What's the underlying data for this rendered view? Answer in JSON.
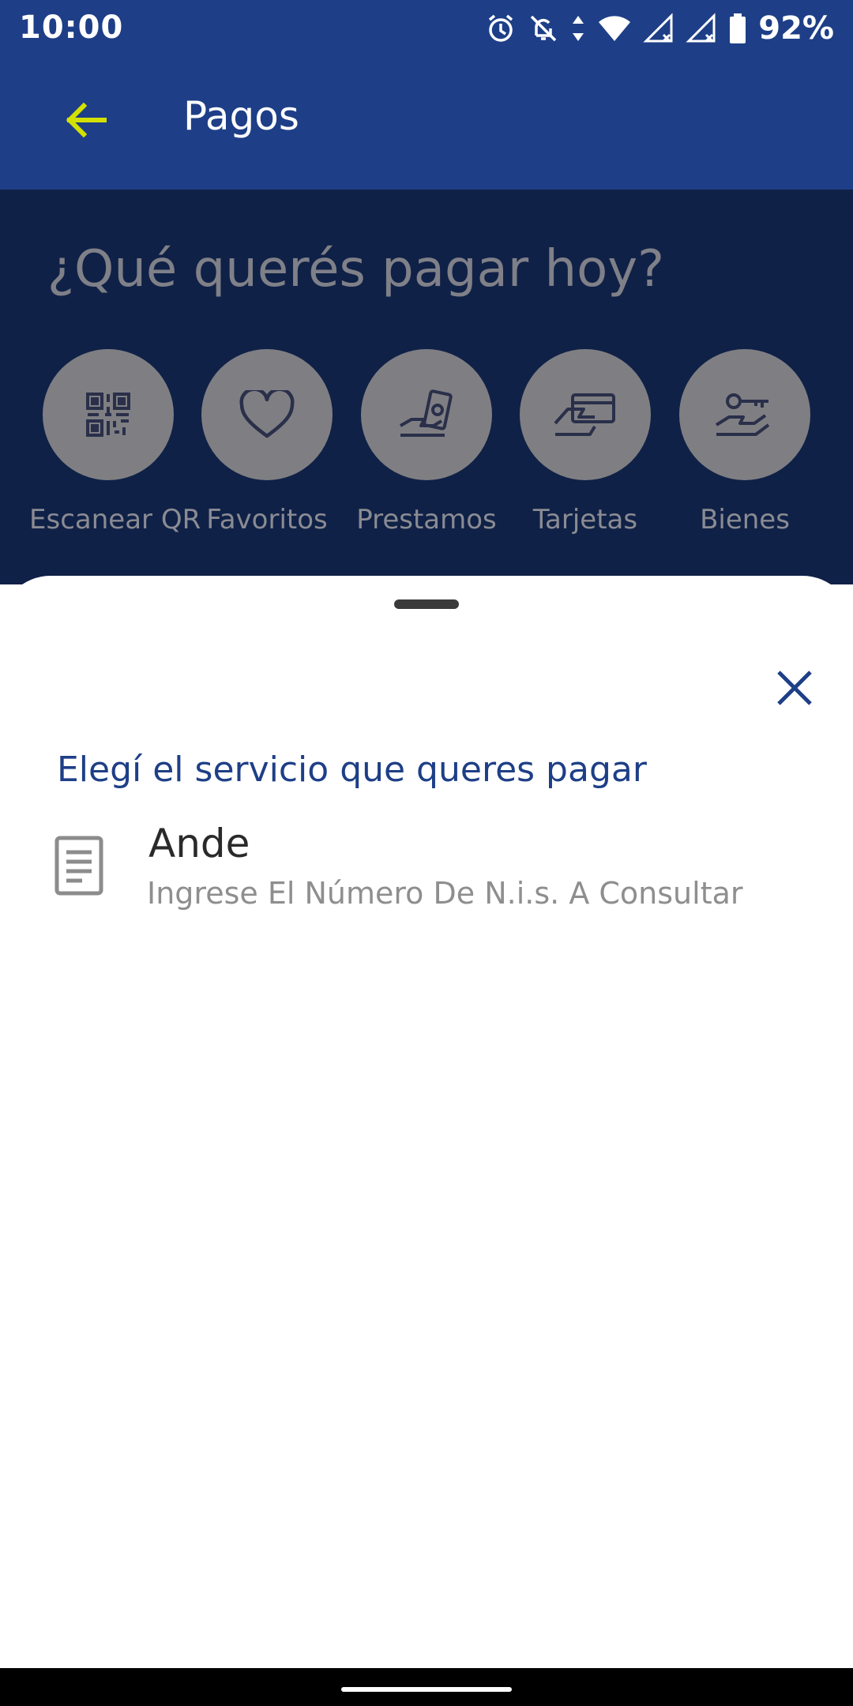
{
  "status_bar": {
    "time": "10:00",
    "battery": "92%",
    "icons": [
      "alarm-icon",
      "notifications-off-icon",
      "data-arrows-icon",
      "wifi-icon",
      "signal-icon",
      "signal-icon",
      "battery-icon"
    ]
  },
  "app_bar": {
    "title": "Pagos",
    "back_icon": "arrow-left-icon",
    "back_color": "#d4e000",
    "background": "#1e3f87"
  },
  "main": {
    "question": "¿Qué querés pagar hoy?",
    "actions": [
      {
        "label": "Escanear QR",
        "icon": "qr-code-icon"
      },
      {
        "label": "Favoritos",
        "icon": "heart-icon"
      },
      {
        "label": "Prestamos",
        "icon": "hand-money-icon"
      },
      {
        "label": "Tarjetas",
        "icon": "hand-card-icon"
      },
      {
        "label": "Bienes",
        "icon": "hand-key-icon"
      }
    ]
  },
  "sheet": {
    "heading": "Elegí el servicio que queres pagar",
    "close_icon": "close-icon",
    "services": [
      {
        "title": "Ande",
        "subtitle": "Ingrese El Número De N.i.s. A Consultar",
        "icon": "document-icon"
      }
    ]
  },
  "colors": {
    "accent": "#1e3f87",
    "scrim": "#102147",
    "text_primary": "#2a2a2a",
    "text_secondary": "#8e8e8e"
  }
}
